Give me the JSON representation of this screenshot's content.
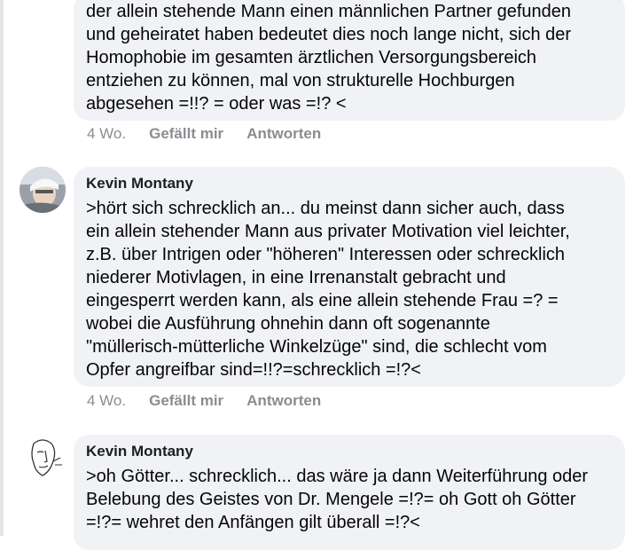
{
  "comments": [
    {
      "author": "",
      "text": "der allein stehende Mann einen männlichen Partner gefunden\nund geheiratet haben bedeutet dies noch lange nicht, sich der\nHomophobie im gesamten ärztlichen Versorgungsbereich\nentziehen zu können, mal von strukturelle Hochburgen\nabgesehen =!!? = oder was =!? <",
      "time": "4 Wo.",
      "like_label": "Gefällt mir",
      "reply_label": "Antworten"
    },
    {
      "author": "Kevin Montany",
      "avatar_icon": "profile-photo-icon",
      "text": ">hört sich schrecklich an... du meinst dann sicher auch, dass\nein allein stehender Mann aus privater Motivation viel leichter,\nz.B. über Intrigen oder \"höheren\" Interessen oder schrecklich\nniederer Motivlagen, in eine Irrenanstalt gebracht und\neingesperrt werden kann, als eine allein stehende Frau =? =\nwobei die Ausführung ohnehin dann oft sogenannte\n\"müllerisch-mütterliche  Winkelzüge\" sind, die schlecht vom\nOpfer angreifbar sind=!!?=schrecklich =!?<",
      "time": "4 Wo.",
      "like_label": "Gefällt mir",
      "reply_label": "Antworten"
    },
    {
      "author": "Kevin Montany",
      "avatar_icon": "face-sketch-icon",
      "text": ">oh Götter... schrecklich... das wäre ja dann Weiterführung oder\nBelebung des Geistes von  Dr. Mengele =!?= oh Gott oh Götter\n=!?= wehret den Anfängen gilt überall =!?<"
    }
  ],
  "colors": {
    "bubble": "#f0f2f5",
    "text": "#050505",
    "meta": "#8a8d91"
  }
}
